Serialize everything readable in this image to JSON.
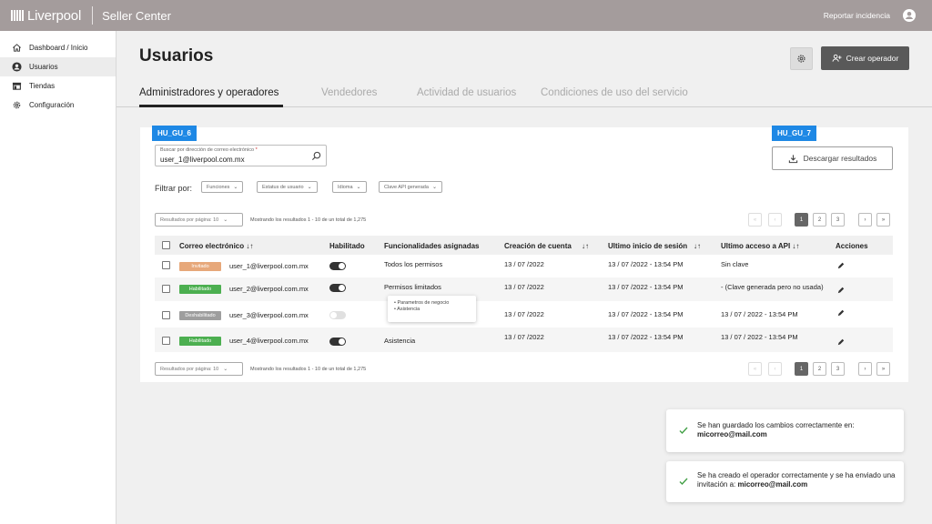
{
  "topbar": {
    "brand": "Liverpool",
    "app_name": "Seller Center",
    "report_link": "Reportar incidencia"
  },
  "sidebar": {
    "items": [
      {
        "label": "Dashboard / Inicio",
        "icon": "home-icon"
      },
      {
        "label": "Usuarios",
        "icon": "user-circle-icon",
        "active": true
      },
      {
        "label": "Tiendas",
        "icon": "store-icon"
      },
      {
        "label": "Configuración",
        "icon": "gear-icon"
      }
    ]
  },
  "header": {
    "title": "Usuarios",
    "create_button": "Crear operador"
  },
  "tabs": [
    {
      "label": "Administradores y operadores",
      "active": true
    },
    {
      "label": "Vendedores"
    },
    {
      "label": "Actividad de usuarios"
    },
    {
      "label": "Condiciones de uso del servicio"
    }
  ],
  "tags": {
    "search": "HU_GU_6",
    "download": "HU_GU_7"
  },
  "search": {
    "label": "Buscar por dirección de correo electrónico",
    "required_mark": "*",
    "value": "user_1@liverpool.com.mx"
  },
  "download_button": "Descargar resultados",
  "filters": {
    "label": "Filtrar por:",
    "chips": [
      "Funciones",
      "Estatus de usuario",
      "Idioma",
      "Clave API generada"
    ]
  },
  "pagination": {
    "per_page": "Resultados por página: 10",
    "results_top": "Mostrando los resultados 1 - 10 de un total de 1,275",
    "results_bottom": "Mostrando los resultados 1 - 10 de un total de 1,275",
    "pages": [
      "1",
      "2",
      "3"
    ],
    "current_page": 1,
    "first": "«",
    "prev": "‹",
    "next": "›",
    "last": "»"
  },
  "table": {
    "columns": [
      "Correo electrónico",
      "Habilitado",
      "Funcionalidades asignadas",
      "Creación de cuenta",
      "Ultimo inicio de sesión",
      "Ultimo acceso a API",
      "Acciones"
    ],
    "rows": [
      {
        "status": "Invitado",
        "email": "user_1@liverpool.com.mx",
        "enabled": true,
        "functions": "Todos los permisos",
        "created": "13 / 07 /2022",
        "last_login": "13 / 07 /2022 - 13:54 PM",
        "last_api": "Sin clave"
      },
      {
        "status": "Habilitado",
        "email": "user_2@liverpool.com.mx",
        "enabled": true,
        "functions": "Permisos limitados",
        "created": "13 / 07 /2022",
        "last_login": "13 / 07 /2022 - 13:54 PM",
        "last_api": "- (Clave generada pero no usada)"
      },
      {
        "status": "Deshabilitado",
        "email": "user_3@liverpool.com.mx",
        "enabled": false,
        "functions": "",
        "created": "13 / 07 /2022",
        "last_login": "13 / 07 /2022 - 13:54 PM",
        "last_api": "13 / 07 / 2022 - 13:54 PM"
      },
      {
        "status": "Habilitado",
        "email": "user_4@liverpool.com.mx",
        "enabled": true,
        "functions": "Asistencia",
        "created": "13 / 07 /2022",
        "last_login": "13 / 07 /2022 - 13:54 PM",
        "last_api": "13 / 07 / 2022 - 13:54 PM"
      }
    ],
    "permissions_popup": [
      "Parametros de negocio",
      "Asistencia"
    ]
  },
  "toasts": [
    {
      "text": "Se han guardado los cambios correctamente en:",
      "email": "micorreo@mail.com"
    },
    {
      "text": "Se ha creado el operador correctamente y se ha enviado una invitación a:",
      "email": "micorreo@mail.com"
    }
  ],
  "colors": {
    "topbar": "#a49c9c",
    "tag": "#1e88e5",
    "invited": "#e7a87a",
    "enabled": "#4caf50",
    "disabled": "#9e9e9e",
    "primary_button": "#595959",
    "success_check": "#43a047"
  }
}
